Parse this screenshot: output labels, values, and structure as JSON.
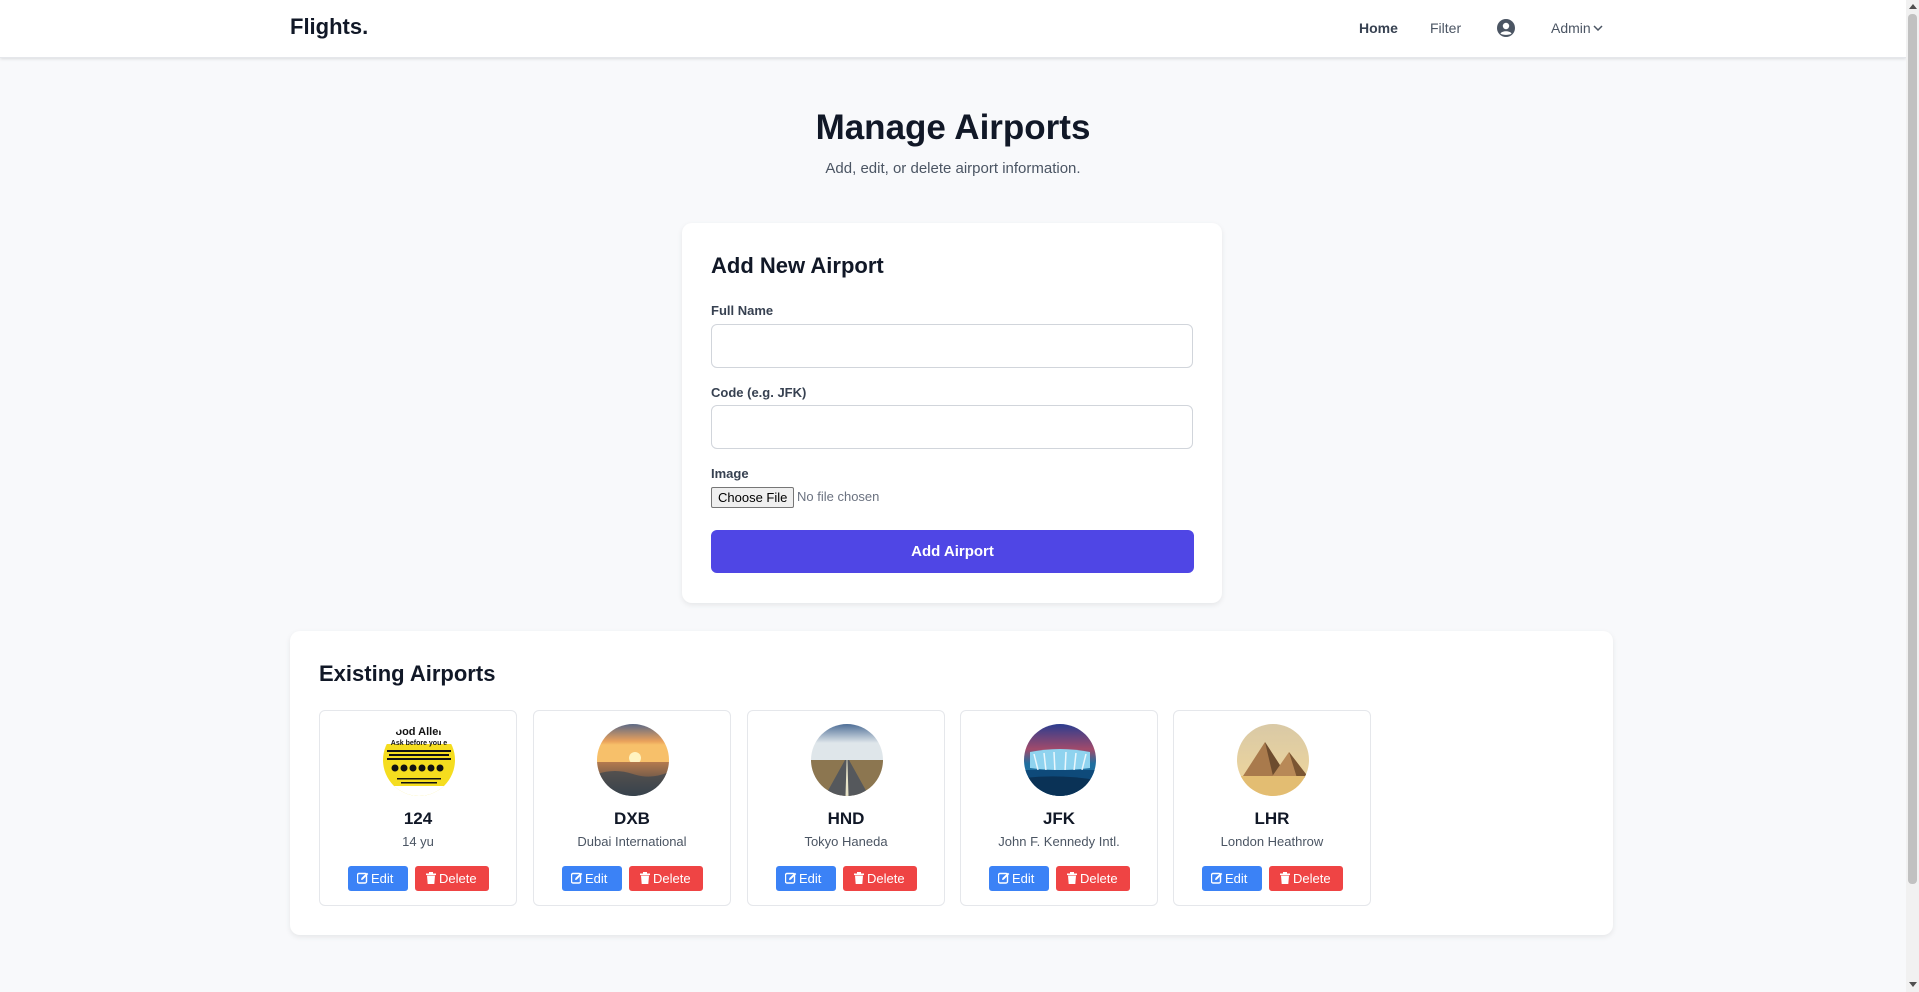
{
  "nav": {
    "brand": "Flights.",
    "home": "Home",
    "filter": "Filter",
    "user_icon": "user-circle-icon",
    "admin": "Admin"
  },
  "header": {
    "title": "Manage Airports",
    "subtitle": "Add, edit, or delete airport information."
  },
  "form": {
    "title": "Add New Airport",
    "full_name_label": "Full Name",
    "full_name_value": "",
    "code_label": "Code (e.g. JFK)",
    "code_value": "",
    "image_label": "Image",
    "choose_file": "Choose File",
    "file_status": "No file chosen",
    "submit": "Add Airport"
  },
  "list": {
    "title": "Existing Airports",
    "edit_label": "Edit",
    "delete_label": "Delete",
    "airports": [
      {
        "code": "124",
        "name": "14 yu",
        "image": "food-allergy-sign"
      },
      {
        "code": "DXB",
        "name": "Dubai International",
        "image": "sunset-over-sea"
      },
      {
        "code": "HND",
        "name": "Tokyo Haneda",
        "image": "road-to-horizon"
      },
      {
        "code": "JFK",
        "name": "John F. Kennedy Intl.",
        "image": "waterfall"
      },
      {
        "code": "LHR",
        "name": "London Heathrow",
        "image": "pyramids"
      }
    ]
  },
  "colors": {
    "primary": "#4f46e5",
    "edit": "#3b82f6",
    "delete": "#ef4444"
  }
}
